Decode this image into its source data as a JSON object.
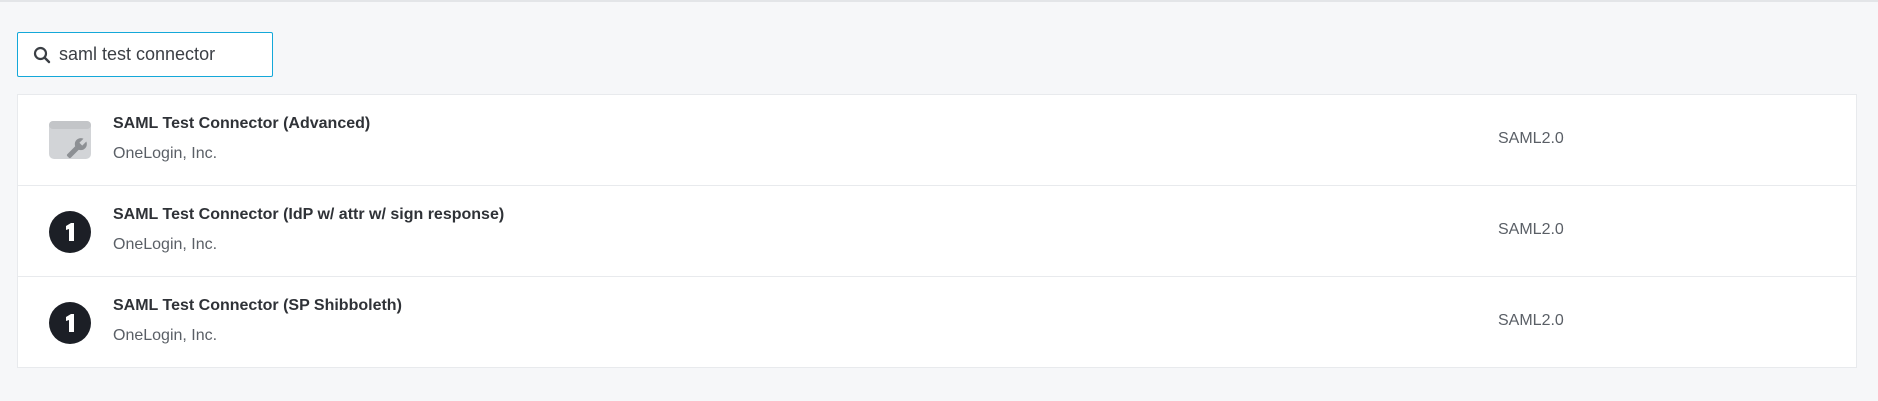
{
  "search": {
    "value": "saml test connector",
    "icon": "search-icon"
  },
  "results": [
    {
      "name": "SAML Test Connector (Advanced)",
      "vendor": "OneLogin, Inc.",
      "protocol": "SAML2.0",
      "icon": "wrench-window-icon"
    },
    {
      "name": "SAML Test Connector (IdP w/ attr w/ sign response)",
      "vendor": "OneLogin, Inc.",
      "protocol": "SAML2.0",
      "icon": "onelogin-logo-icon"
    },
    {
      "name": "SAML Test Connector (SP Shibboleth)",
      "vendor": "OneLogin, Inc.",
      "protocol": "SAML2.0",
      "icon": "onelogin-logo-icon"
    }
  ],
  "colors": {
    "background": "#f6f7f9",
    "search_border": "#14a8d9",
    "logo_dark": "#1c1f26"
  }
}
